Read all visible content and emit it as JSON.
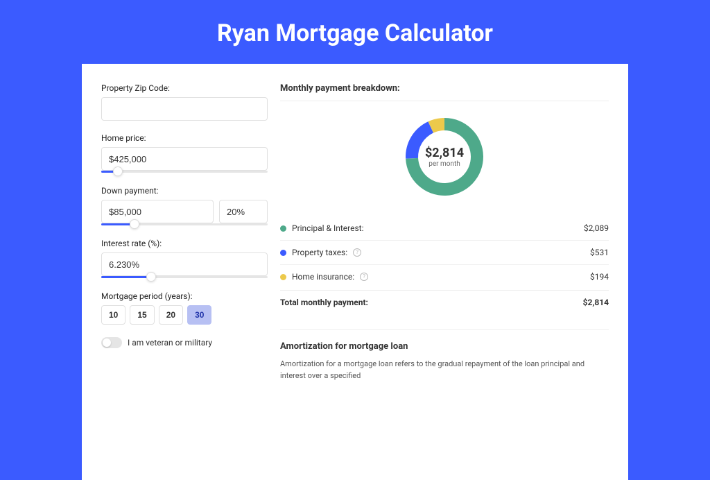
{
  "title": "Ryan Mortgage Calculator",
  "form": {
    "zip": {
      "label": "Property Zip Code:",
      "value": ""
    },
    "home_price": {
      "label": "Home price:",
      "value": "$425,000",
      "slider_percent": 10
    },
    "down_payment": {
      "label": "Down payment:",
      "amount": "$85,000",
      "percent": "20%",
      "slider_percent": 20
    },
    "interest_rate": {
      "label": "Interest rate (%):",
      "value": "6.230%",
      "slider_percent": 30
    },
    "period": {
      "label": "Mortgage period (years):",
      "options": [
        "10",
        "15",
        "20",
        "30"
      ],
      "selected": "30"
    },
    "veteran": {
      "label": "I am veteran or military",
      "on": false
    }
  },
  "breakdown": {
    "title": "Monthly payment breakdown:",
    "center_value": "$2,814",
    "center_sub": "per month",
    "items": [
      {
        "label": "Principal & Interest:",
        "value": "$2,089",
        "color": "#4ea98a",
        "help": false
      },
      {
        "label": "Property taxes:",
        "value": "$531",
        "color": "#3b5bff",
        "help": true
      },
      {
        "label": "Home insurance:",
        "value": "$194",
        "color": "#ecc94b",
        "help": true
      }
    ],
    "total_label": "Total monthly payment:",
    "total_value": "$2,814"
  },
  "amortization": {
    "title": "Amortization for mortgage loan",
    "text": "Amortization for a mortgage loan refers to the gradual repayment of the loan principal and interest over a specified"
  },
  "chart_data": {
    "type": "pie",
    "title": "Monthly payment breakdown",
    "series": [
      {
        "name": "Principal & Interest",
        "value": 2089,
        "color": "#4ea98a"
      },
      {
        "name": "Property taxes",
        "value": 531,
        "color": "#3b5bff"
      },
      {
        "name": "Home insurance",
        "value": 194,
        "color": "#ecc94b"
      }
    ],
    "total": 2814,
    "center_label": "$2,814 per month"
  }
}
